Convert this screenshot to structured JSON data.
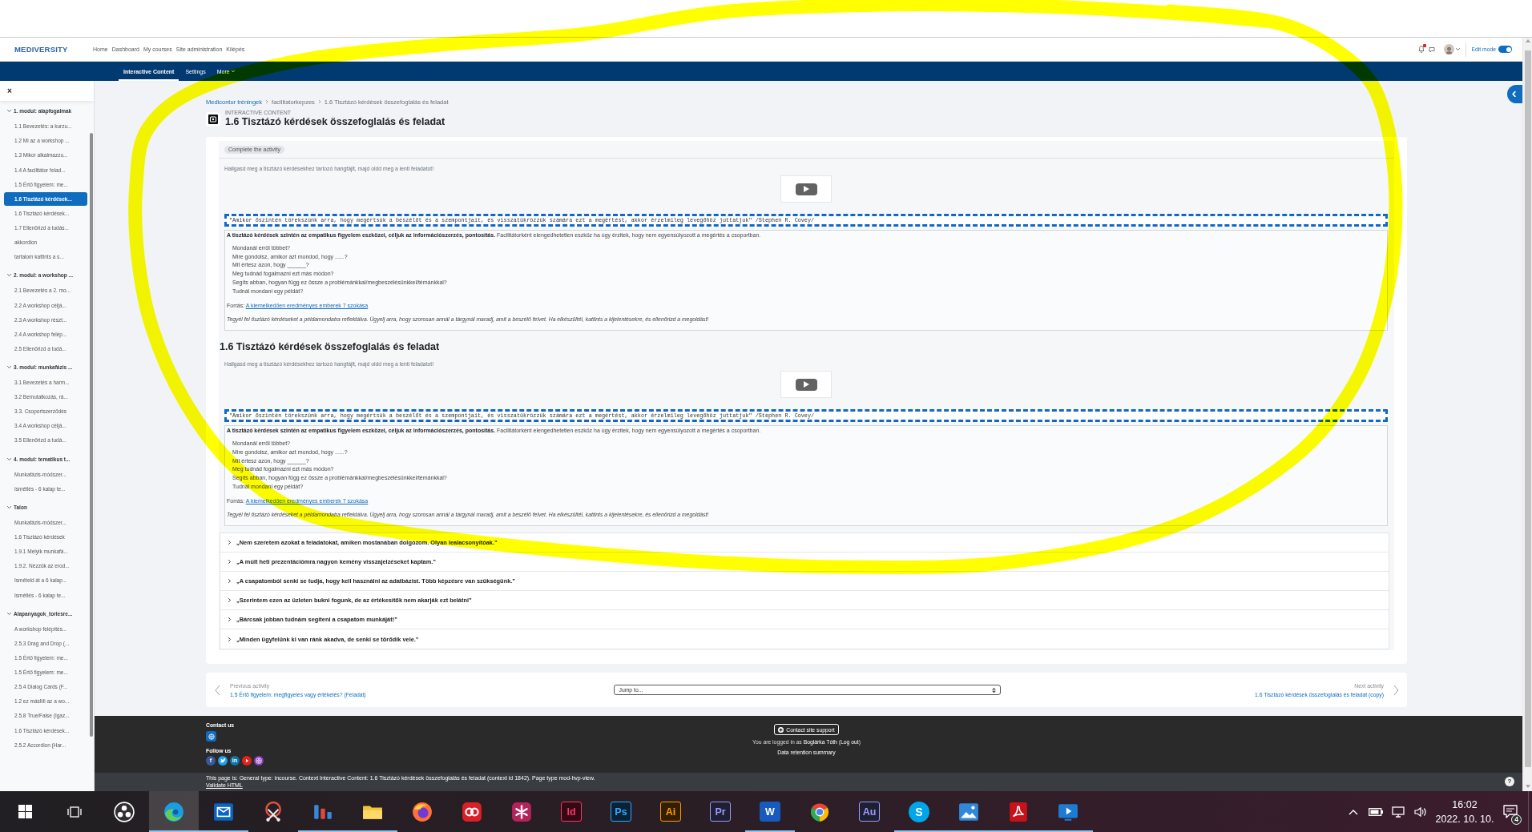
{
  "header": {
    "logo": "MEDIVERSITY",
    "nav": [
      "Home",
      "Dashboard",
      "My courses",
      "Site administration",
      "Kilépés"
    ],
    "edit_mode": {
      "label": "Edit mode",
      "on": true
    }
  },
  "secondary_nav": [
    {
      "label": "Interactive Content",
      "selected": true,
      "kind": "link"
    },
    {
      "label": "Settings",
      "selected": false,
      "kind": "link"
    },
    {
      "label": "More",
      "selected": false,
      "kind": "dropdown"
    }
  ],
  "course_index": {
    "close": "×",
    "sections": [
      {
        "title": "1. modul: alapfogalmak",
        "expanded": true,
        "items": [
          {
            "label": "1.1 Bevezetés: a kurzu...",
            "selected": false
          },
          {
            "label": "1.2 Mi az a workshop ...",
            "selected": false
          },
          {
            "label": "1.3 Mikor alkalmazzu...",
            "selected": false
          },
          {
            "label": "1.4 A facilitátor felad...",
            "selected": false
          },
          {
            "label": "1.5 Értő figyelem: me...",
            "selected": false
          },
          {
            "label": "1.6 Tisztázó kérdések...",
            "selected": true
          },
          {
            "label": "1.6 Tisztázó kérdések...",
            "selected": false
          },
          {
            "label": "1.7 Ellenőrizd a tudás...",
            "selected": false
          },
          {
            "label": "akkordion",
            "selected": false
          },
          {
            "label": "tartalom kattints a s...",
            "selected": false
          }
        ]
      },
      {
        "title": "2. modul: a workshop ...",
        "expanded": true,
        "items": [
          {
            "label": "2.1 Bevezetés a 2. mo...",
            "selected": false
          },
          {
            "label": "2.2 A workshop céljá...",
            "selected": false
          },
          {
            "label": "2.3 A workshop részt...",
            "selected": false
          },
          {
            "label": "2.4 A workshop felép...",
            "selected": false
          },
          {
            "label": "2.5 Ellenőrizd a tudá...",
            "selected": false
          }
        ]
      },
      {
        "title": "3. modul: munkafázis ...",
        "expanded": true,
        "items": [
          {
            "label": "3.1 Bevezetés a harm...",
            "selected": false
          },
          {
            "label": "3.2 Bemutatkozás, rá...",
            "selected": false
          },
          {
            "label": "3.3. Csoportszerződés",
            "selected": false
          },
          {
            "label": "3.4 A workshop céljá...",
            "selected": false
          },
          {
            "label": "3.5 Ellenőrizd a tudá...",
            "selected": false
          }
        ]
      },
      {
        "title": "4. modul: tematikus t...",
        "expanded": true,
        "items": [
          {
            "label": "Munkafázis-módszer...",
            "selected": false
          },
          {
            "label": "Ismétlés - 6 kalap te...",
            "selected": false
          }
        ]
      },
      {
        "title": "Talon",
        "expanded": true,
        "items": [
          {
            "label": "Munkafázis-módszer...",
            "selected": false
          },
          {
            "label": "1.6 Tisztázó kérdések",
            "selected": false
          },
          {
            "label": "1.9.1 Melyik munkafá...",
            "selected": false
          },
          {
            "label": "1.9.2. Nézzük az erod...",
            "selected": false
          },
          {
            "label": "Ismételd át a 6 kalap...",
            "selected": false
          },
          {
            "label": "Ismétlés - 6 kalap te...",
            "selected": false
          }
        ]
      },
      {
        "title": "Alapanyagok_torlesre...",
        "expanded": true,
        "items": [
          {
            "label": "A workshop felépítés...",
            "selected": false
          },
          {
            "label": "2.5.3 Drag and Drop (...",
            "selected": false
          },
          {
            "label": "1.5 Értő figyelem: me...",
            "selected": false
          },
          {
            "label": "1.5 Értő figyelem: me...",
            "selected": false
          },
          {
            "label": "2.5.4 Dialog Cards (F...",
            "selected": false
          },
          {
            "label": "1.2 ez másMi az a wo...",
            "selected": false
          },
          {
            "label": "2.5.8 True/False (Igaz...",
            "selected": false
          },
          {
            "label": "1.6 Tisztázó kérdések...",
            "selected": false
          },
          {
            "label": "2.5.2 Accordion (Har...",
            "selected": false
          }
        ]
      }
    ]
  },
  "breadcrumb": [
    {
      "label": "Medicontur tréningek",
      "kind": "link"
    },
    {
      "label": "facilitatorkepzes",
      "kind": "muted"
    },
    {
      "label": "1.6 Tisztázó kérdések összefoglalás és feladat",
      "kind": "muted"
    }
  ],
  "activity": {
    "type_label": "INTERACTIVE CONTENT",
    "title": "1.6 Tisztázó kérdések összefoglalás és feladat",
    "completion": "Complete the activity"
  },
  "blocks": [
    {
      "instruction": "Hallgasd meg a tisztázó kérdésekhez tartozó hangfájlt, majd oldd meg a lenti feladatot!",
      "quote": "\"Amikor őszintén törekszünk arra, hogy megértsük a beszélőt és a szempontjait, és visszatükrözzük számára ezt a megértést, akkor érzelmileg levegőhöz juttatjuk\" /Stephen R. Covey/",
      "lead": "**A tisztázó kérdések szintén az empatikus figyelem eszközei, céljuk az információszerzés, pontosítás.** Facilitátorként elengedhetetlen eszköz ha úgy érzitek, hogy nem egyensúlyozott a megértés a csoportban.",
      "questions": [
        "Mondanál erről többet?",
        "Mire gondolsz, amikor azt mondod, hogy ......?",
        "Mit értesz azon, hogy ______?",
        "Meg tudnád fogalmazni ezt más módon?",
        "Segíts abban, hogyan függ ez össze a problémánkkal/megbeszélésünkkel/témánkkal?",
        "Tudnál mondani egy példát?"
      ],
      "source": {
        "label": "Forrás:",
        "link": "A kiemelkedően eredményes emberek 7 szokása"
      },
      "task": "Tegyél fel tisztázó kérdéseket a példamondatra reflektálva. Ügyelj arra, hogy szorosan annál a tárgynál maradj, amit a beszélő felvet. Ha elkészültél, kattints a kijelentésekre, és ellenőrizd a megoldást!"
    },
    {
      "heading": "1.6 Tisztázó kérdések összefoglalás és feladat",
      "instruction": "Hallgasd meg a tisztázó kérdésekhez tartozó hangfájlt, majd oldd meg a lenti feladatot!",
      "quote": "\"Amikor őszintén törekszünk arra, hogy megértsük a beszélőt és a szempontjait, és visszatükrözzük számára ezt a megértést, akkor érzelmileg levegőhöz juttatjuk\" /Stephen R. Covey/",
      "lead": "**A tisztázó kérdések szintén az empatikus figyelem eszközei, céljuk az információszerzés, pontosítás.** Facilitátorként elengedhetetlen eszköz ha úgy érzitek, hogy nem egyensúlyozott a megértés a csoportban.",
      "questions": [
        "Mondanál erről többet?",
        "Mire gondolsz, amikor azt mondod, hogy ......?",
        "Mit értesz azon, hogy ______?",
        "Meg tudnád fogalmazni ezt más módon?",
        "Segíts abban, hogyan függ ez össze a problémánkkal/megbeszélésünkkel/témánkkal?",
        "Tudnál mondani egy példát?"
      ],
      "source": {
        "label": "Forrás:",
        "link": "A kiemelkedően eredményes emberek 7 szokása"
      },
      "task": "Tegyél fel tisztázó kérdéseket a példamondatra reflektálva. Ügyelj arra, hogy szorosan annál a tárgynál maradj, amit a beszélő felvet. Ha elkészültél, kattints a kijelentésekre, és ellenőrizd a megoldást!"
    }
  ],
  "statements": [
    {
      "text": "„Nem szeretem azokat a feladatokat, amiken mostanában dolgozom. Olyan lealacsonyítóak.”",
      "expanded": false
    },
    {
      "text": "„A múlt heti prezentációmra nagyon kemény visszajelzéseket kaptam.”",
      "expanded": false
    },
    {
      "text": "„A csapatomból senki se tudja, hogy kell használni az adatbázist. Több képzésre van szükségünk.”",
      "expanded": false
    },
    {
      "text": "„Szerintem ezen az üzleten bukni fogunk, de az értékesítők nem akarják ezt belátni”",
      "expanded": false
    },
    {
      "text": "„Bárcsak jobban tudnám segíteni a csapatom munkáját!”",
      "expanded": false
    },
    {
      "text": "„Minden ügyfelünk ki van ránk akadva, de senki se törődik vele.”",
      "expanded": false
    }
  ],
  "activity_nav": {
    "previous": {
      "label": "Previous activity",
      "link": "1.5 Értő figyelem: megfigyelés vagy értékelés? (Feladat)"
    },
    "jump_to": {
      "value": "Jump to..."
    },
    "next": {
      "label": "Next activity",
      "link": "1.6 Tisztázó kérdések összefoglalás és feladat (copy)"
    }
  },
  "footer": {
    "contact_title": "Contact us",
    "follow_title": "Follow us",
    "social": [
      {
        "kind": "letter",
        "glyph": "f",
        "color": "#3b5998"
      },
      {
        "kind": "bird",
        "color": "#1da1f2"
      },
      {
        "kind": "letter",
        "glyph": "in",
        "color": "#0e76a8"
      },
      {
        "kind": "play",
        "color": "#e62117"
      },
      {
        "kind": "camera",
        "color": "#8a3ab9"
      }
    ],
    "support_button": "Contact site support",
    "logged_in": [
      {
        "kind": "text",
        "text": "You are logged in as "
      },
      {
        "kind": "link",
        "text": "Boglárka Tóth"
      },
      {
        "kind": "text",
        "text": " ("
      },
      {
        "kind": "link",
        "text": "Log out"
      },
      {
        "kind": "text",
        "text": ")"
      }
    ],
    "data_retention": "Data retention summary",
    "page_info": "This page is: General type: incourse. Context Interactive Content: 1.6 Tisztázó kérdések összefoglalás és feladat (context id 1842). Page type mod-hvp-view.",
    "validate": "Validate HTML",
    "help": "?"
  },
  "taskbar": {
    "apps": [
      {
        "kind": "ring",
        "color": "#302e31",
        "selected": false,
        "running": false
      },
      {
        "kind": "swirl",
        "color": "#1b9de2",
        "selected": true,
        "running": true
      },
      {
        "kind": "envelope",
        "color": "#0a64c1",
        "selected": false,
        "running": true
      },
      {
        "kind": "scissors",
        "color": "#e8513c",
        "selected": false,
        "running": false
      },
      {
        "kind": "bars",
        "color": "#3a86d9",
        "selected": false,
        "running": true
      },
      {
        "kind": "folder",
        "color": "#f3c338",
        "selected": false,
        "running": true
      },
      {
        "kind": "globe",
        "color": "#ff7139",
        "selected": false,
        "running": false
      },
      {
        "kind": "loops",
        "color": "#da1f26",
        "selected": false,
        "running": false
      },
      {
        "kind": "asterisk",
        "color": "#b3245d",
        "selected": false,
        "running": false
      },
      {
        "kind": "letters",
        "label": "Id",
        "color": "#ff3366",
        "selected": false,
        "running": false
      },
      {
        "kind": "letters",
        "label": "Ps",
        "color": "#31a8ff",
        "selected": false,
        "running": false
      },
      {
        "kind": "letters",
        "label": "Ai",
        "color": "#ff9a00",
        "selected": false,
        "running": false
      },
      {
        "kind": "letters",
        "label": "Pr",
        "color": "#9999ff",
        "selected": false,
        "running": false
      },
      {
        "kind": "tile",
        "label": "W",
        "color": "#185abd",
        "selected": false,
        "running": true
      },
      {
        "kind": "segments",
        "color": "#4285f4",
        "selected": false,
        "running": false
      },
      {
        "kind": "letters",
        "label": "Au",
        "color": "#9999ff",
        "selected": false,
        "running": false
      },
      {
        "kind": "disc",
        "label": "S",
        "color": "#00a6e8",
        "selected": false,
        "running": true
      },
      {
        "kind": "landscape",
        "color": "#2f88d8",
        "selected": false,
        "running": true
      },
      {
        "kind": "ribbon",
        "color": "#c8121a",
        "selected": false,
        "running": true
      },
      {
        "kind": "screen",
        "color": "#1e7bd0",
        "selected": false,
        "running": true
      }
    ],
    "clock": {
      "time": "16:02",
      "date": "2022. 10. 10."
    },
    "notifications": "4"
  }
}
